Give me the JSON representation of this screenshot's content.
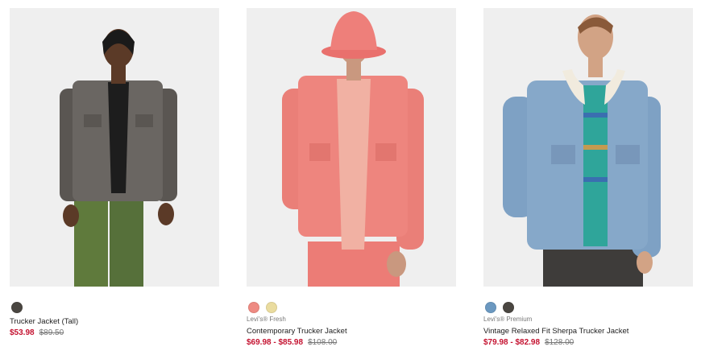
{
  "products": [
    {
      "subtitle": "",
      "title": "Trucker Jacket (Tall)",
      "sale_price": "$53.98",
      "original_price": "$89.50",
      "swatches": [
        "#4a4641"
      ]
    },
    {
      "subtitle": "Levi's® Fresh",
      "title": "Contemporary Trucker Jacket",
      "sale_price": "$69.98 - $85.98",
      "original_price": "$108.00",
      "swatches": [
        "#ee8a82",
        "#eadc9f"
      ]
    },
    {
      "subtitle": "Levi's® Premium",
      "title": "Vintage Relaxed Fit Sherpa Trucker Jacket",
      "sale_price": "$79.98 - $82.98",
      "original_price": "$128.00",
      "swatches": [
        "#6b98c0",
        "#4a4641"
      ]
    }
  ],
  "colors": {
    "sale": "#c41230",
    "image_bg": "#efefef"
  }
}
